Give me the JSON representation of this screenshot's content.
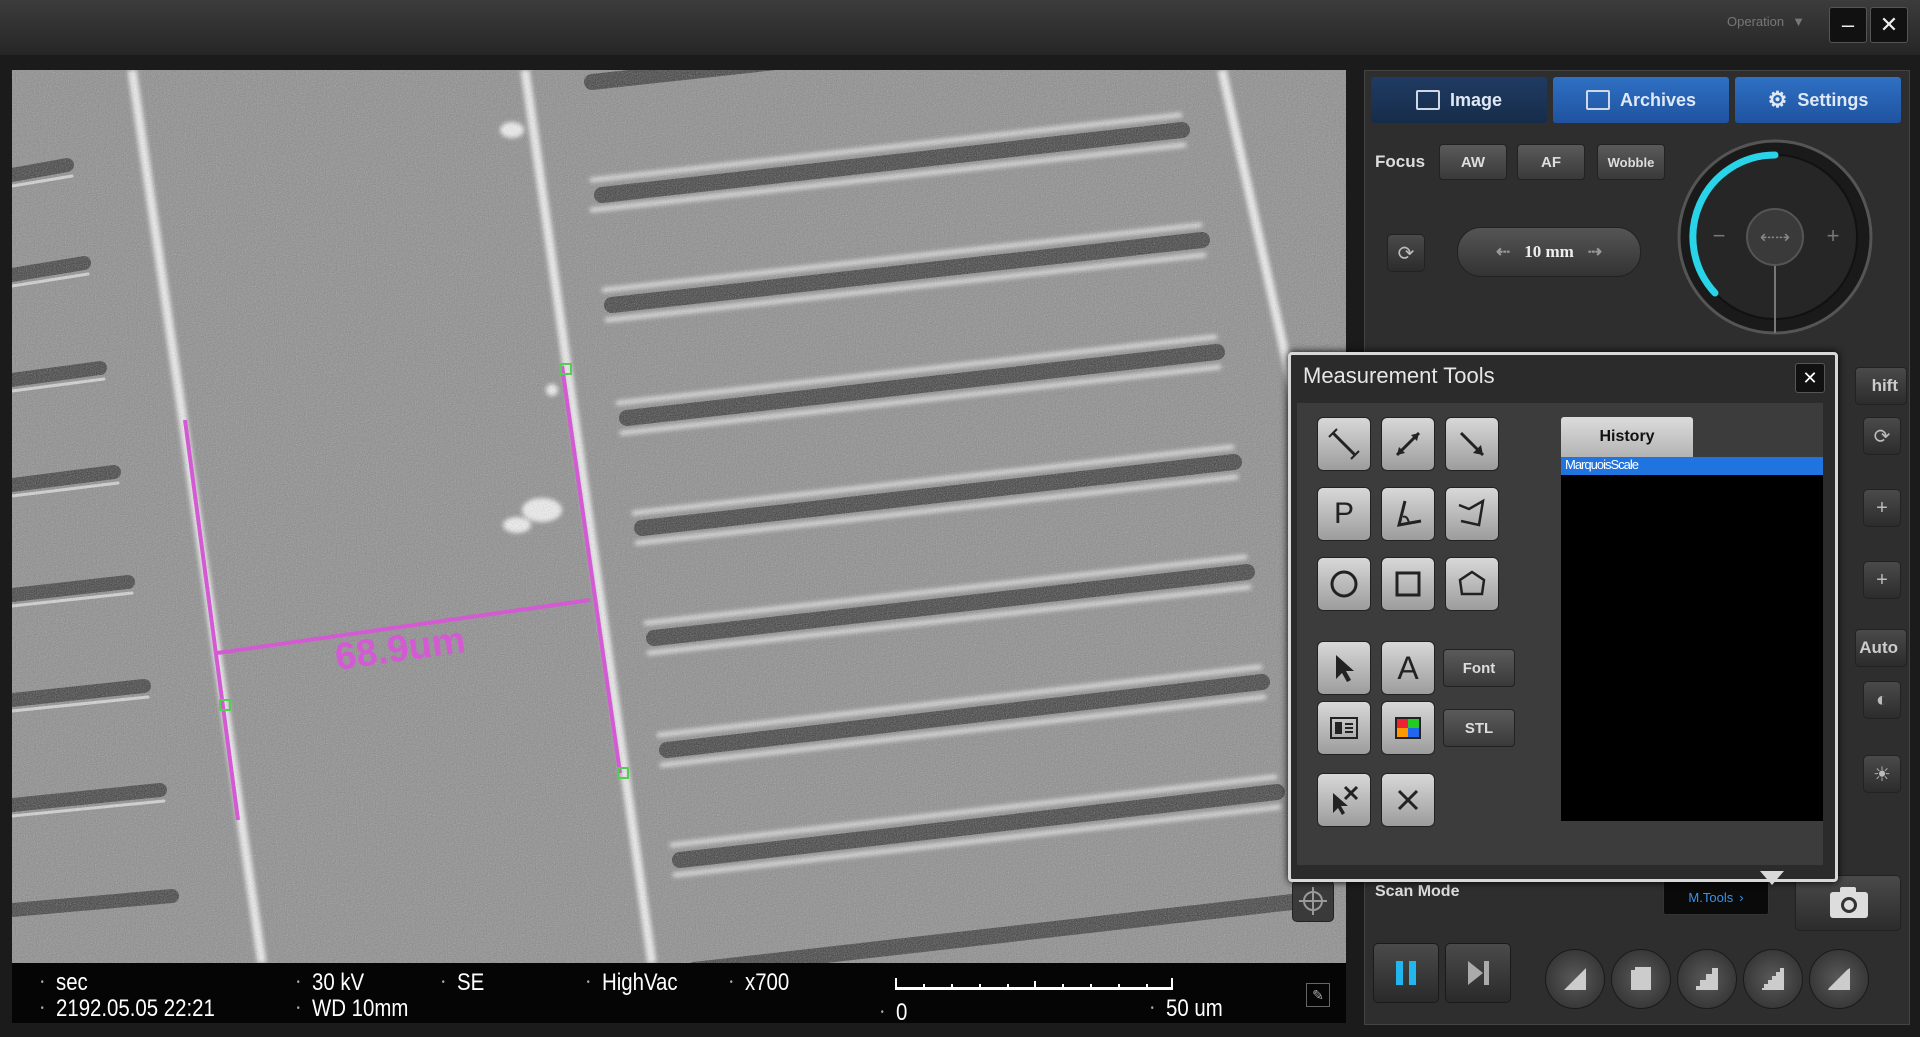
{
  "titlebar": {
    "operation_label": "Operation"
  },
  "sem_image": {
    "measurement_label": "68.9um"
  },
  "status_bar": {
    "mode": "sec",
    "datetime": "2192.05.05 22:21",
    "voltage": "30 kV",
    "working_distance": "WD 10mm",
    "detector": "SE",
    "vacuum": "HighVac",
    "magnification": "x700",
    "scale_start": "0",
    "scale_end": "50 um"
  },
  "tabs": [
    {
      "label": "Image",
      "icon": "image-icon"
    },
    {
      "label": "Archives",
      "icon": "archive-icon"
    },
    {
      "label": "Settings",
      "icon": "gear-icon"
    }
  ],
  "focus": {
    "label": "Focus",
    "aw": "AW",
    "af": "AF",
    "wobble": "Wobble",
    "step": "10 mm"
  },
  "side_buttons": {
    "shift": "hift",
    "auto": "Auto"
  },
  "scan_mode": {
    "label": "Scan Mode",
    "mtools": "M.Tools"
  },
  "measurement_tools": {
    "title": "Measurement Tools",
    "font_button": "Font",
    "stl_button": "STL",
    "history_tab": "History",
    "history_items": [
      "MarquoisScale"
    ]
  },
  "colors": {
    "accent": "#2f70c3",
    "measure": "#d45ad4",
    "knob_arc": "#29d3e8",
    "pause_icon": "#22b6ee"
  }
}
